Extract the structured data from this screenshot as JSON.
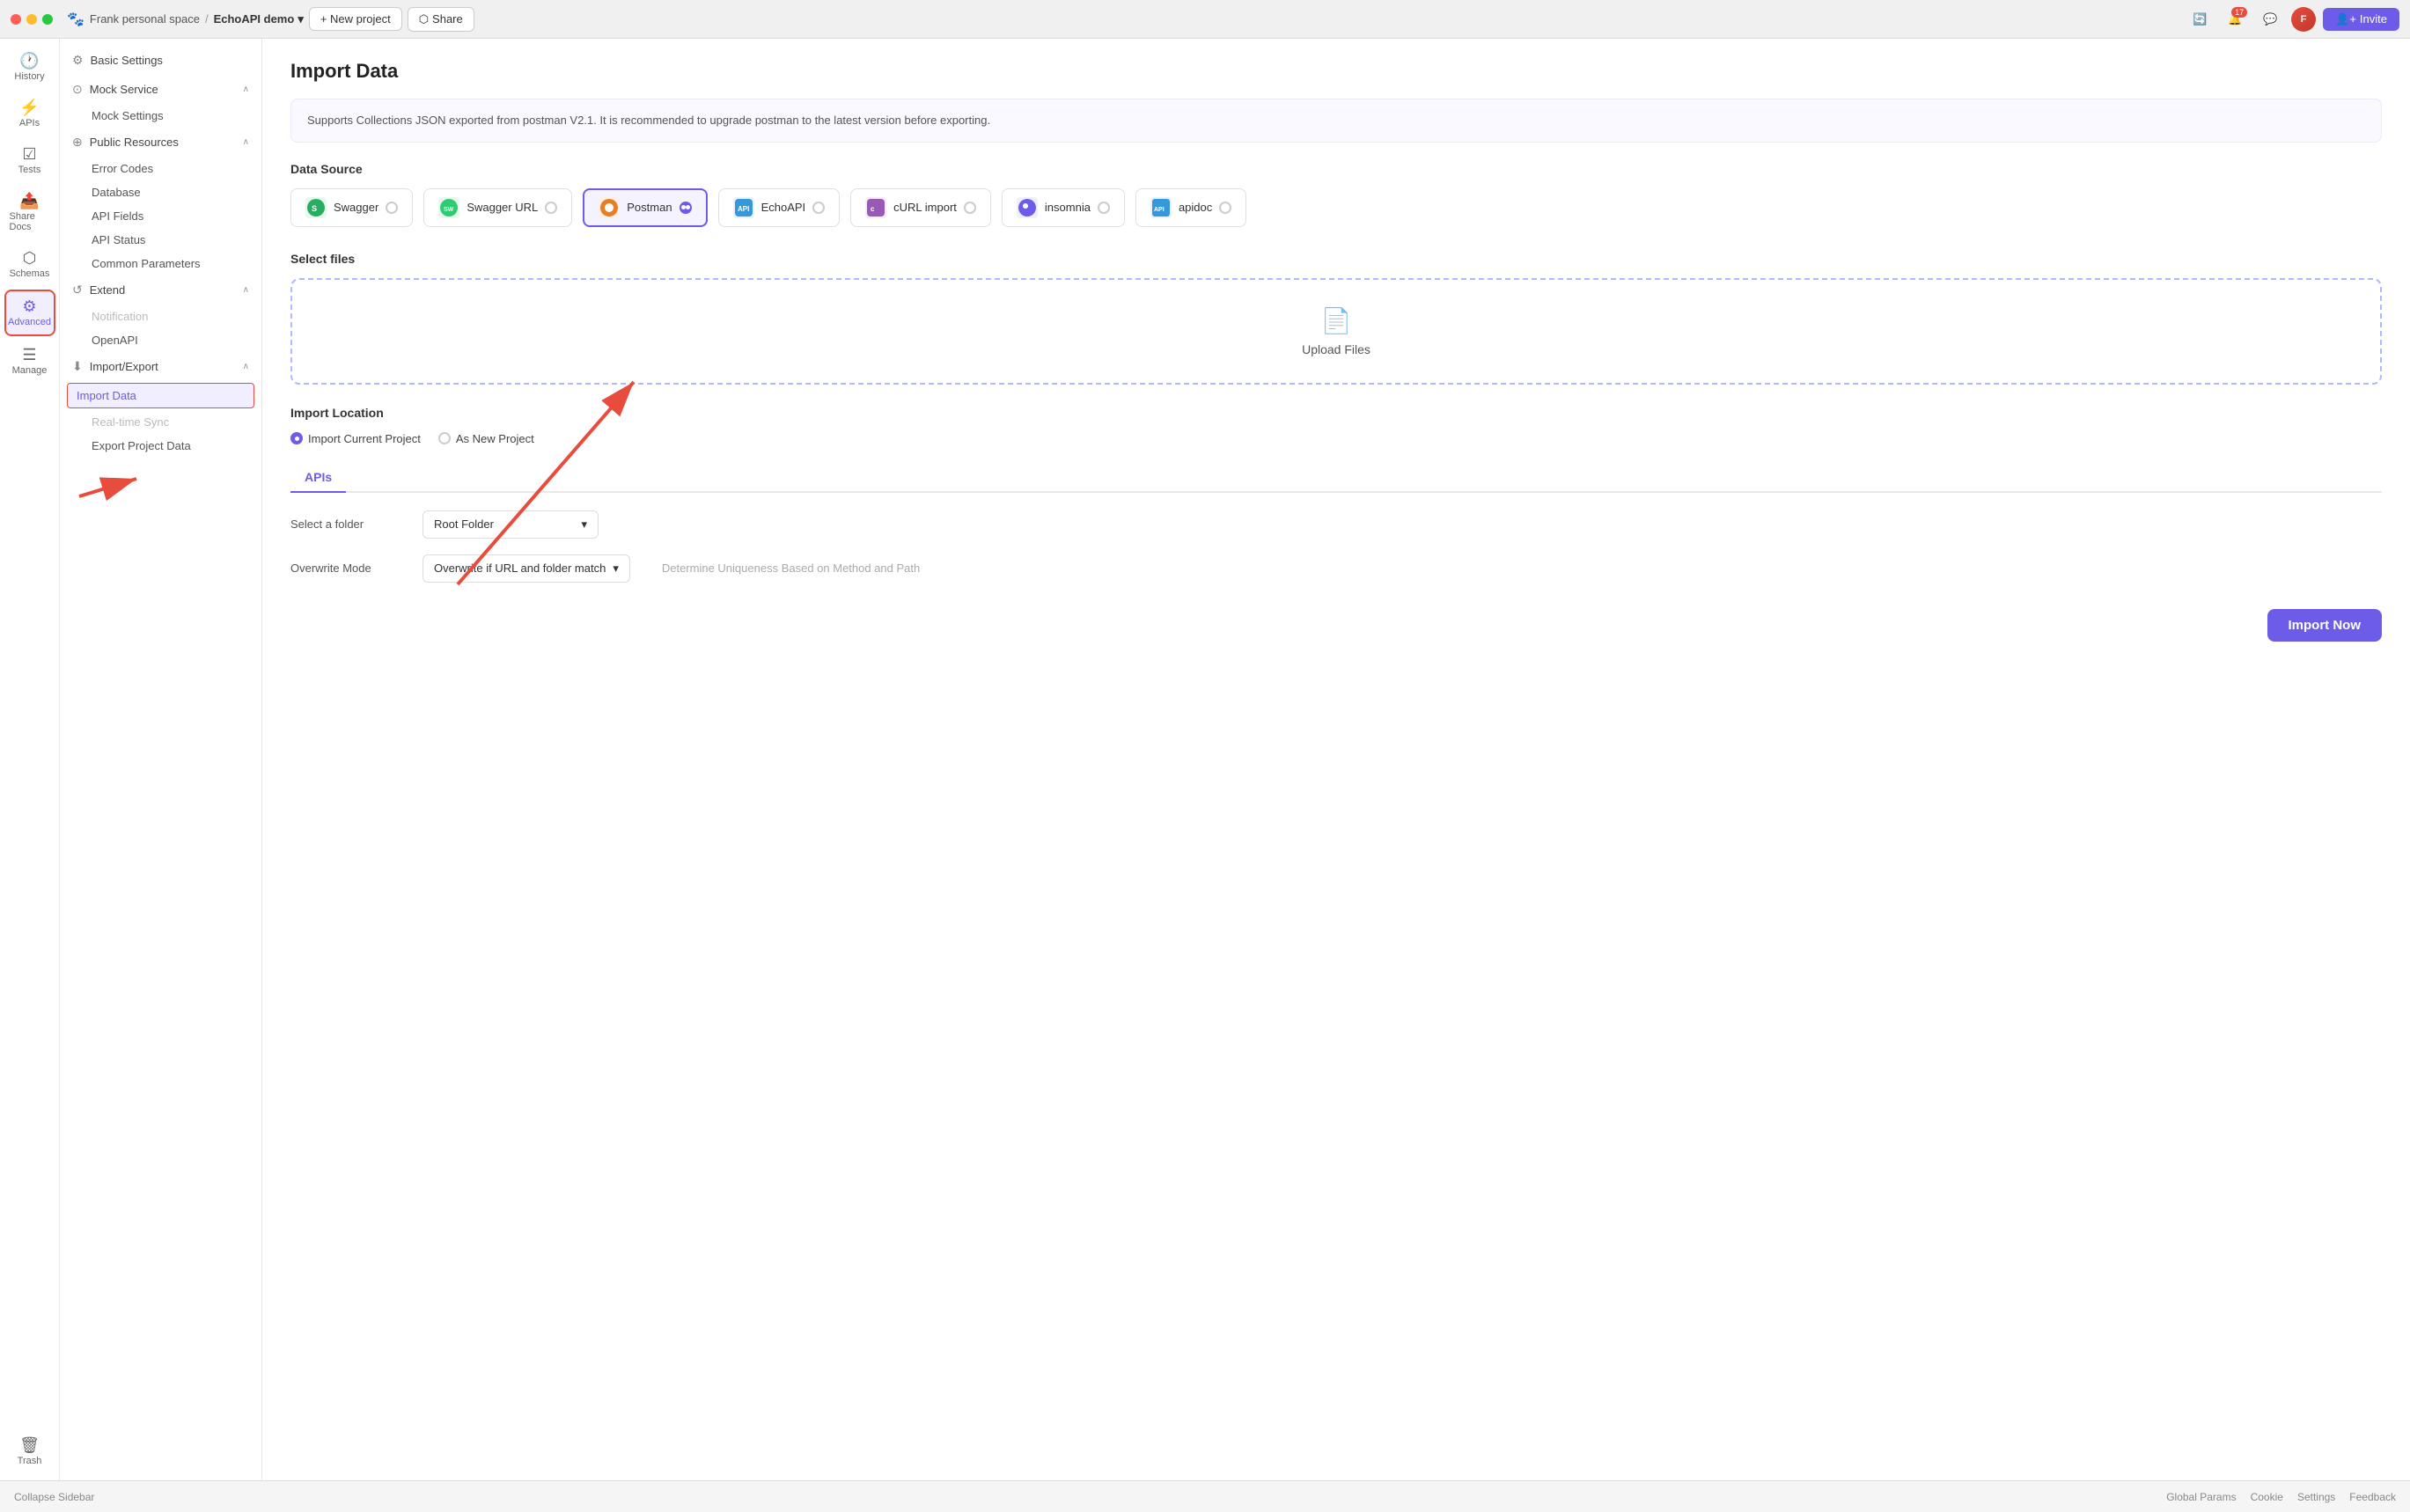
{
  "titlebar": {
    "traffic_lights": [
      "red",
      "yellow",
      "green"
    ],
    "space_label": "Frank personal space",
    "breadcrumb_sep": "/",
    "project_name": "EchoAPI demo",
    "chevron": "▾",
    "new_project_label": "+ New project",
    "share_label": "Share",
    "invite_label": "Invite",
    "notification_count": "17"
  },
  "left_nav": {
    "items": [
      {
        "id": "history",
        "label": "History",
        "icon": "🕐",
        "active": false
      },
      {
        "id": "apis",
        "label": "APIs",
        "icon": "⚡",
        "active": false
      },
      {
        "id": "tests",
        "label": "Tests",
        "icon": "☑",
        "active": false
      },
      {
        "id": "share-docs",
        "label": "Share Docs",
        "icon": "📤",
        "active": false
      },
      {
        "id": "schemas",
        "label": "Schemas",
        "icon": "⬡",
        "active": false
      },
      {
        "id": "advanced",
        "label": "Advanced",
        "icon": "⚙",
        "active": true
      },
      {
        "id": "manage",
        "label": "Manage",
        "icon": "☰",
        "active": false
      }
    ],
    "bottom": [
      {
        "id": "trash",
        "label": "Trash",
        "icon": "🗑",
        "active": false
      }
    ]
  },
  "sidebar": {
    "basic_settings": "Basic Settings",
    "mock_service": "Mock Service",
    "mock_settings": "Mock Settings",
    "public_resources": "Public Resources",
    "error_codes": "Error Codes",
    "database": "Database",
    "api_fields": "API Fields",
    "api_status": "API Status",
    "common_parameters": "Common Parameters",
    "extend": "Extend",
    "notification": "Notification",
    "openapi": "OpenAPI",
    "import_export": "Import/Export",
    "import_data": "Import Data",
    "realtime_sync": "Real-time Sync",
    "export_project_data": "Export Project Data"
  },
  "main": {
    "page_title": "Import Data",
    "info_text": "Supports Collections JSON exported from postman V2.1. It is recommended to upgrade postman to the latest version before exporting.",
    "data_source_label": "Data Source",
    "data_sources": [
      {
        "id": "swagger",
        "label": "Swagger",
        "icon_color": "#27ae60",
        "icon_text": "S",
        "selected": false
      },
      {
        "id": "swagger-url",
        "label": "Swagger URL",
        "icon_color": "#27ae60",
        "icon_text": "SU",
        "selected": false
      },
      {
        "id": "postman",
        "label": "Postman",
        "icon_color": "#e67e22",
        "icon_text": "P",
        "selected": true
      },
      {
        "id": "echoapi",
        "label": "EchoAPI",
        "icon_color": "#3498db",
        "icon_text": "E",
        "selected": false
      },
      {
        "id": "curl",
        "label": "cURL import",
        "icon_color": "#9b59b6",
        "icon_text": "C",
        "selected": false
      },
      {
        "id": "insomnia",
        "label": "insomnia",
        "icon_color": "#6c5ce7",
        "icon_text": "I",
        "selected": false
      },
      {
        "id": "apidoc",
        "label": "apidoc",
        "icon_color": "#3498db",
        "icon_text": "A",
        "selected": false
      }
    ],
    "select_files_label": "Select files",
    "upload_files_label": "Upload Files",
    "import_location_label": "Import Location",
    "import_current_project": "Import Current Project",
    "as_new_project": "As New Project",
    "tab_apis": "APIs",
    "select_folder_label": "Select a folder",
    "root_folder": "Root Folder",
    "overwrite_mode_label": "Overwrite Mode",
    "overwrite_option": "Overwrite if URL and folder match",
    "uniqueness_placeholder": "Determine Uniqueness Based on Method and Path",
    "import_now_label": "Import Now"
  },
  "bottom_bar": {
    "collapse_sidebar": "Collapse Sidebar",
    "global_params": "Global Params",
    "cookie": "Cookie",
    "settings": "Settings",
    "feedback": "Feedback"
  }
}
